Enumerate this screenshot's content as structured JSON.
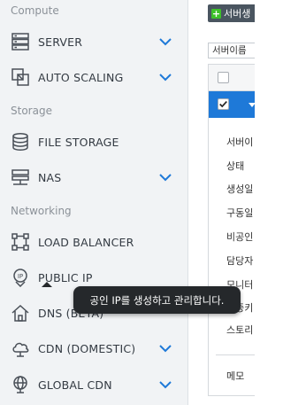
{
  "sidebar": {
    "sections": [
      {
        "title": "Compute"
      },
      {
        "title": "Storage"
      },
      {
        "title": "Networking"
      }
    ],
    "items": [
      {
        "label": "SERVER",
        "icon": "server-icon",
        "expandable": true
      },
      {
        "label": "AUTO SCALING",
        "icon": "auto-scaling-icon",
        "expandable": true
      },
      {
        "label": "FILE STORAGE",
        "icon": "database-icon",
        "expandable": false
      },
      {
        "label": "NAS",
        "icon": "nas-icon",
        "expandable": true
      },
      {
        "label": "LOAD BALANCER",
        "icon": "load-balancer-icon",
        "expandable": false
      },
      {
        "label": "PUBLIC IP",
        "icon": "public-ip-icon",
        "expandable": false
      },
      {
        "label": "DNS (BETA)",
        "icon": "home-icon",
        "expandable": false
      },
      {
        "label": "CDN (DOMESTIC)",
        "icon": "cloud-icon",
        "expandable": true
      },
      {
        "label": "GLOBAL CDN",
        "icon": "globe-icon",
        "expandable": true
      }
    ]
  },
  "tooltip": {
    "text": "공인 IP를 생성하고 관리합니다."
  },
  "content": {
    "create_button": "서버생",
    "filter_select": "서버이름",
    "details": [
      "서버이",
      "상태",
      "생성일",
      "구동일",
      "비공인",
      "담당자",
      "모니터",
      "인증키",
      "스토리",
      "메모"
    ]
  },
  "colors": {
    "sidebar_bg": "#f1f3f5",
    "chevron": "#1e79d8",
    "selected_row": "#1e79d8",
    "tooltip_bg": "#25282b",
    "create_button_bg": "#4a5560",
    "plus_green": "#3ec12a"
  }
}
